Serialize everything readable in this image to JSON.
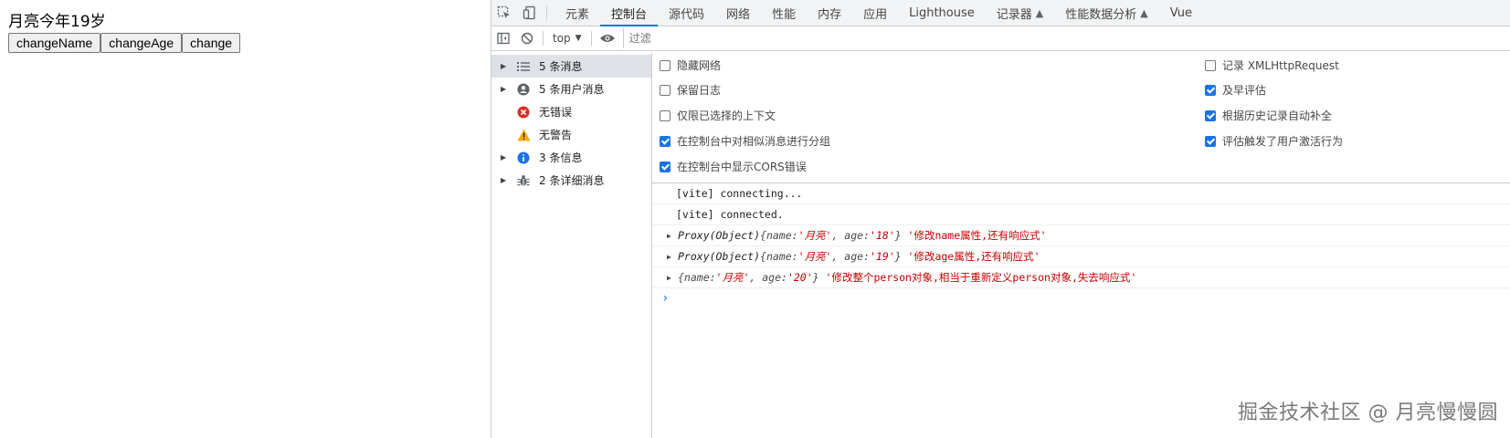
{
  "page": {
    "title": "月亮今年19岁",
    "buttons": [
      "changeName",
      "changeAge",
      "change"
    ]
  },
  "devtools": {
    "tabs": [
      {
        "label": "元素"
      },
      {
        "label": "控制台",
        "active": true
      },
      {
        "label": "源代码"
      },
      {
        "label": "网络"
      },
      {
        "label": "性能"
      },
      {
        "label": "内存"
      },
      {
        "label": "应用"
      },
      {
        "label": "Lighthouse"
      },
      {
        "label": "记录器",
        "experimental": true
      },
      {
        "label": "性能数据分析",
        "experimental": true
      },
      {
        "label": "Vue"
      }
    ],
    "toolbar": {
      "context": "top",
      "filter_placeholder": "过滤"
    },
    "sidebar": [
      {
        "label": "5 条消息",
        "icon": "list-icon",
        "expandable": true,
        "selected": true
      },
      {
        "label": "5 条用户消息",
        "icon": "user-icon",
        "expandable": true
      },
      {
        "label": "无错误",
        "icon": "error-icon",
        "expandable": false
      },
      {
        "label": "无警告",
        "icon": "warning-icon",
        "expandable": false
      },
      {
        "label": "3 条信息",
        "icon": "info-icon",
        "expandable": true
      },
      {
        "label": "2 条详细消息",
        "icon": "bug-icon",
        "expandable": true
      }
    ],
    "settings_left": [
      {
        "label": "隐藏网络",
        "checked": false
      },
      {
        "label": "保留日志",
        "checked": false
      },
      {
        "label": "仅限已选择的上下文",
        "checked": false
      },
      {
        "label": "在控制台中对相似消息进行分组",
        "checked": true
      },
      {
        "label": "在控制台中显示CORS错误",
        "checked": true
      }
    ],
    "settings_right": [
      {
        "label": "记录 XMLHttpRequest",
        "checked": false
      },
      {
        "label": "及早评估",
        "checked": true
      },
      {
        "label": "根据历史记录自动补全",
        "checked": true
      },
      {
        "label": "评估触发了用户激活行为",
        "checked": true
      }
    ],
    "console": {
      "plain": [
        "[vite] connecting...",
        "[vite] connected."
      ],
      "logs": [
        {
          "prefix": "Proxy(Object) ",
          "name": "'月亮'",
          "age": "'18'",
          "msg": "'修改name属性,还有响应式'"
        },
        {
          "prefix": "Proxy(Object) ",
          "name": "'月亮'",
          "age": "'19'",
          "msg": "'修改age属性,还有响应式'"
        },
        {
          "prefix": "",
          "name": "'月亮'",
          "age": "'20'",
          "msg": "'修改整个person对象,相当于重新定义person对象,失去响应式'"
        }
      ],
      "prompt": "›"
    },
    "watermark": "掘金技术社区 @ 月亮慢慢圆"
  },
  "colors": {
    "accent": "#1a73e8",
    "string_red": "#c80000",
    "error_red": "#d93025",
    "warning_yellow": "#f9ab00",
    "info_blue": "#1a73e8"
  }
}
